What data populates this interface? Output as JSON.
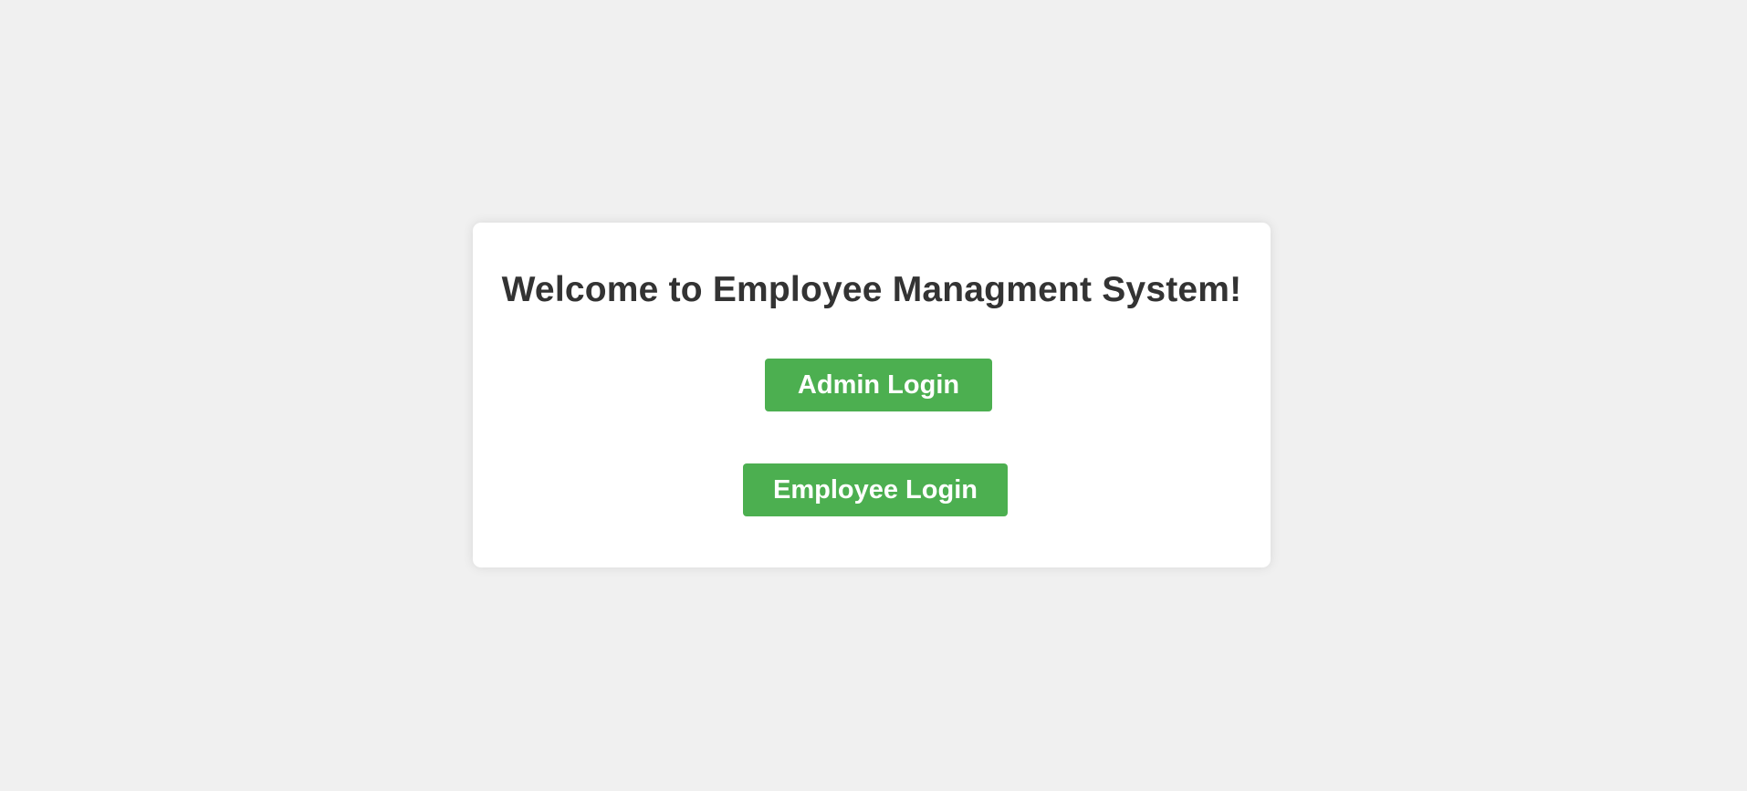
{
  "page": {
    "background_color": "#f0f0f0"
  },
  "card": {
    "title": "Welcome to Employee Managment System!",
    "background_color": "#ffffff",
    "title_color": "#333333"
  },
  "buttons": {
    "admin_login_label": "Admin Login",
    "employee_login_label": "Employee Login",
    "accent_color": "#4caf50",
    "text_color": "#ffffff"
  }
}
